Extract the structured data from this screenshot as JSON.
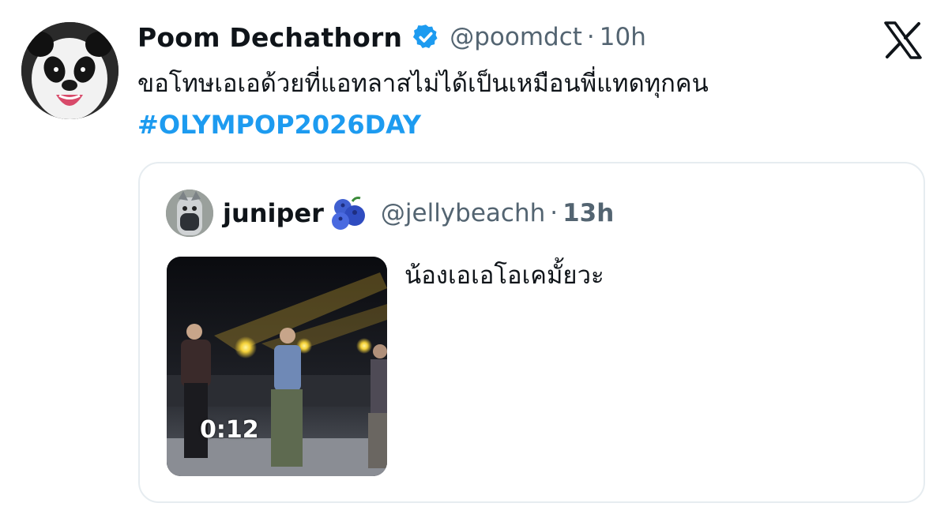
{
  "tweet": {
    "display_name": "Poom Dechathorn",
    "handle": "@poomdct",
    "separator": "·",
    "time": "10h",
    "text": "ขอโทษเอเอด้วยที่แอทลาสไม่ได้เป็นเหมือนพี่แทดทุกคน",
    "hashtag": "#OLYMPOP2026DAY",
    "avatar_icon": "panda-avatar",
    "verified_icon": "verified-badge-icon",
    "brand_icon": "x-logo-icon"
  },
  "quote": {
    "display_name": "juniper",
    "emoji": "blueberries-emoji",
    "handle": "@jellybeachh",
    "separator": "·",
    "time": "13h",
    "text": "น้องเอเอโอเคมั้ยวะ",
    "video_duration": "0:12"
  },
  "colors": {
    "accent": "#1d9bf0",
    "secondary_text": "#536471",
    "primary_text": "#0f1419",
    "card_border": "#e6ecf0"
  }
}
